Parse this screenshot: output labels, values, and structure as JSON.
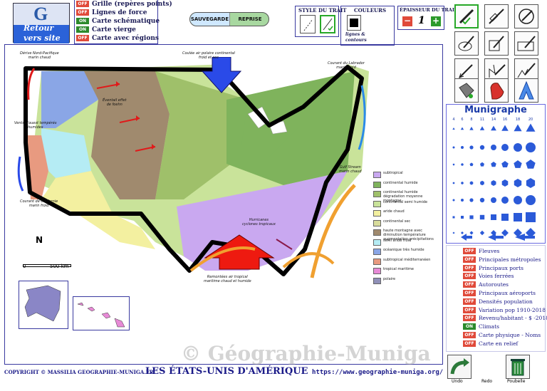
{
  "logo": {
    "letter": "G",
    "line1": "Retour",
    "line2": "vers site"
  },
  "toggles": [
    {
      "state": "OFF",
      "label": "Grille (repères points)"
    },
    {
      "state": "OFF",
      "label": "Lignes de force"
    },
    {
      "state": "ON",
      "label": "Carte schématique"
    },
    {
      "state": "ON",
      "label": "Carte vierge"
    },
    {
      "state": "OFF",
      "label": "Carte avec régions"
    }
  ],
  "save": {
    "save_label": "SAUVEGARDE",
    "reprise_label": "REPRISE"
  },
  "style_panel": {
    "title": "STYLE DU TRAIT"
  },
  "color_panel": {
    "title": "COULEURS",
    "sub1": "lignes &",
    "sub2": "contours"
  },
  "thickness_panel": {
    "title": "ÉPAISSEUR DU TRAIT",
    "minus": "−",
    "value": "1",
    "plus": "+"
  },
  "munigraphe": {
    "title": "Munigraphe",
    "sizes": [
      "4",
      "6",
      "8",
      "11",
      "14",
      "16",
      "18",
      "20"
    ]
  },
  "map": {
    "labels": {
      "nw_pacific": "Dérive Nord-Pacifique\nmarin chaud",
      "polar_cont": "Coulée air polaire continental\nfroid et sec",
      "labrador": "Courant du Labrador\nmarin froid",
      "west_winds": "Vents d'ouest tempérés\nhumides",
      "eventail": "Éventail effet\nde foehn",
      "gulf": "Gulf Stream\nmarin chaud",
      "california": "Courant de Californie\nmarin froid",
      "hurricanes": "Hurricanes\ncyclones tropicaux",
      "remontees": "Remontées air tropical\nmaritime chaud et humide",
      "north": "N",
      "scale_zero": "0",
      "scale_km": "500 km"
    },
    "legend": [
      {
        "color": "#c9a8f0",
        "label": "subtropical"
      },
      {
        "color": "#7fb35c",
        "label": "continental humide"
      },
      {
        "color": "#9fc06a",
        "label": "continental humide dégradation moyenne montagne"
      },
      {
        "color": "#c9e39a",
        "label": "continental semi humide"
      },
      {
        "color": "#f3f0a0",
        "label": "aride chaud"
      },
      {
        "color": "#d8dc9c",
        "label": "continental sec"
      },
      {
        "color": "#a08a6e",
        "label": "haute montagne avec diminution température augmentation précipitations"
      },
      {
        "color": "#b5ecf4",
        "label": "semi aride froid"
      },
      {
        "color": "#8aa6e6",
        "label": "océanique très humide"
      },
      {
        "color": "#e89a80",
        "label": "subtropical méditerranéen"
      },
      {
        "color": "#e78ad6",
        "label": "tropical maritime"
      },
      {
        "color": "#9090b8",
        "label": "polaire"
      }
    ]
  },
  "layers": [
    {
      "state": "OFF",
      "label": "Fleuves"
    },
    {
      "state": "OFF",
      "label": "Principales métropoles"
    },
    {
      "state": "OFF",
      "label": "Principaux ports"
    },
    {
      "state": "OFF",
      "label": "Voies ferrées"
    },
    {
      "state": "OFF",
      "label": "Autoroutes"
    },
    {
      "state": "OFF",
      "label": "Principaux aéroports"
    },
    {
      "state": "OFF",
      "label": "Densités population"
    },
    {
      "state": "OFF",
      "label": "Variation pop 1910-2018"
    },
    {
      "state": "OFF",
      "label": "Revenu/habitant - $ -2018"
    },
    {
      "state": "ON",
      "label": "Climats"
    },
    {
      "state": "OFF",
      "label": "Carte physique - Noms"
    },
    {
      "state": "OFF",
      "label": "Carte en relief"
    }
  ],
  "footer": {
    "copyright": "COPYRIGHT © MASSILIA GEOGRAPHIE-MUNIGA.FR",
    "title": "LES ÉTATS-UNIS D'AMÉRIQUE",
    "url": "https://www.geographie-muniga.org/",
    "watermark": "© Géographie-Muniga"
  },
  "bottom_buttons": {
    "undo": "Undo",
    "redo": "Redo",
    "trash": "Poubelle"
  },
  "colors": {
    "accent": "#2b62d8",
    "frame": "#3a3aa0",
    "on": "#2c8a2c",
    "off": "#e04a3a"
  }
}
